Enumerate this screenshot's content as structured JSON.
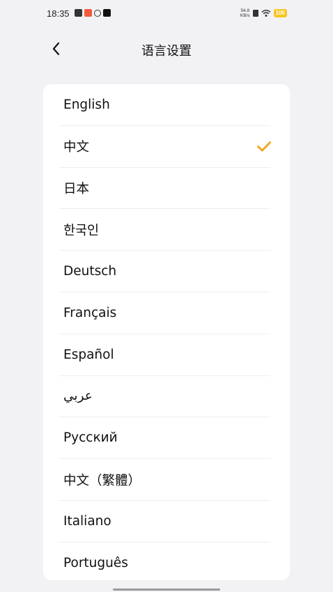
{
  "status_bar": {
    "time": "18:35",
    "net_speed_value": "54.8",
    "net_speed_unit": "KB/s",
    "battery": "100",
    "notification_icons": [
      "app-notification-icon",
      "app-notification-icon",
      "app-notification-icon",
      "tiktok-icon"
    ]
  },
  "header": {
    "back_icon": "chevron-left-icon",
    "title": "语言设置"
  },
  "languages": {
    "items": [
      {
        "label": "English",
        "selected": false
      },
      {
        "label": "中文",
        "selected": true
      },
      {
        "label": "日本",
        "selected": false
      },
      {
        "label": "한국인",
        "selected": false
      },
      {
        "label": "Deutsch",
        "selected": false
      },
      {
        "label": "Français",
        "selected": false
      },
      {
        "label": "Español",
        "selected": false
      },
      {
        "label": "عربي",
        "selected": false
      },
      {
        "label": "Русский",
        "selected": false
      },
      {
        "label": "中文（繁體）",
        "selected": false
      },
      {
        "label": "Italiano",
        "selected": false
      },
      {
        "label": "Português",
        "selected": false
      }
    ],
    "check_icon": "checkmark-icon"
  },
  "colors": {
    "accent": "#f5a623",
    "background": "#f2f2f5",
    "card": "#ffffff",
    "divider": "#eeeeee"
  }
}
